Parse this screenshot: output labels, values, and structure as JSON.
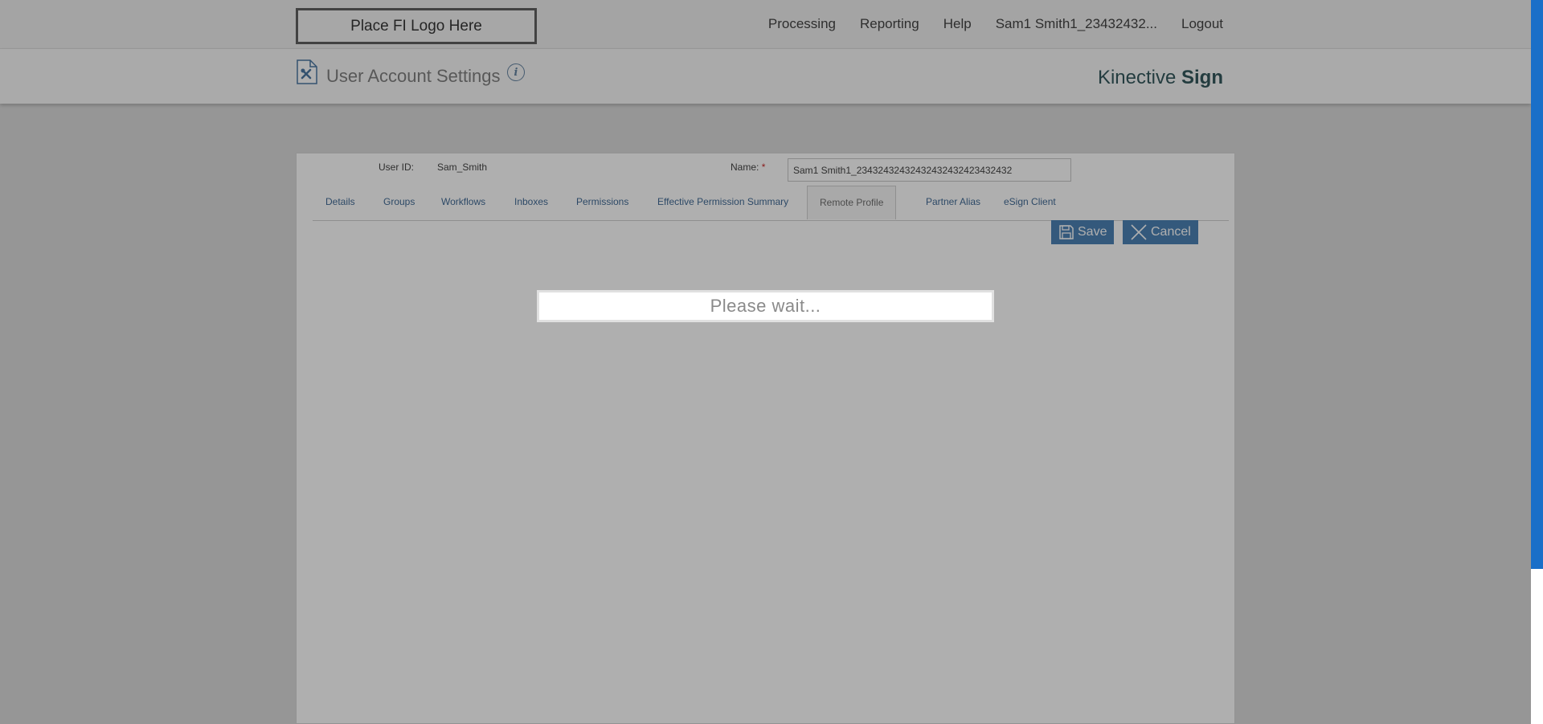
{
  "header": {
    "logo_text": "Place FI Logo Here",
    "nav": [
      "Processing",
      "Reporting",
      "Help",
      "Sam1 Smith1_23432432...",
      "Logout"
    ]
  },
  "subheader": {
    "title": "User Account Settings",
    "info_icon": "info-icon",
    "brand_regular": "Kinective ",
    "brand_bold": "Sign"
  },
  "form": {
    "user_id_label": "User ID:",
    "user_id_value": "Sam_Smith",
    "name_label": "Name:",
    "name_required_marker": "*",
    "name_value": "Sam1 Smith1_23432432432432432432423432432"
  },
  "tabs": [
    {
      "label": "Details",
      "active": false
    },
    {
      "label": "Groups",
      "active": false
    },
    {
      "label": "Workflows",
      "active": false
    },
    {
      "label": "Inboxes",
      "active": false
    },
    {
      "label": "Permissions",
      "active": false
    },
    {
      "label": "Effective Permission Summary",
      "active": false
    },
    {
      "label": "Remote Profile",
      "active": true
    },
    {
      "label": "Partner Alias",
      "active": false
    },
    {
      "label": "eSign Client",
      "active": false
    }
  ],
  "actions": {
    "save_label": "Save",
    "cancel_label": "Cancel"
  },
  "overlay": {
    "message": "Please wait..."
  },
  "colors": {
    "link": "#1e4f82",
    "button": "#2b6ca8",
    "required": "#c00000",
    "scrollbar": "#1a6fc8"
  }
}
